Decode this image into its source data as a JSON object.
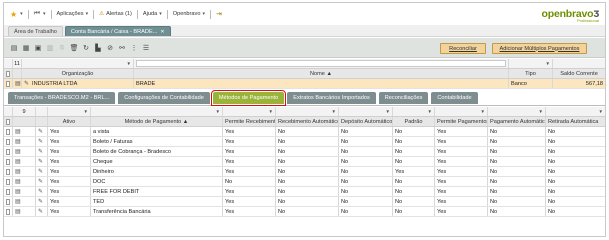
{
  "nav": {
    "applications": "Aplicações",
    "alerts": "Alertas (1)",
    "help": "Ajuda",
    "user": "Openbravo"
  },
  "logo": {
    "main": "openbravo",
    "sub": "Professional"
  },
  "window_tabs": [
    {
      "label": "Área de Trabalho"
    },
    {
      "label": "Conta Bancária / Caixa - BRADE..."
    }
  ],
  "toolbar": {
    "reconcile": "Reconciliar",
    "add_multiple": "Adicionar Múltiplos Pagamentos"
  },
  "header_grid": {
    "filter_count": "11",
    "columns": [
      "Organização",
      "Nome ▲",
      "Tipo",
      "Saldo Corrente"
    ],
    "row": {
      "org": "INDUSTRIA LTDA",
      "name": "BRADE",
      "type": "Banco",
      "balance": "567,18"
    }
  },
  "sub_tabs": [
    {
      "label": "Transações - BRADESCO.M2 - BRL..."
    },
    {
      "label": "Configurações de Contabilidade"
    },
    {
      "label": "Métodos de Pagamento"
    },
    {
      "label": "Extratos Bancários Importados"
    },
    {
      "label": "Reconciliações"
    },
    {
      "label": "Contabilidade"
    }
  ],
  "sub_grid": {
    "filter_count": "9",
    "columns": [
      "Ativo",
      "Método de Pagamento ▲",
      "Permite Recebimento",
      "Recebimento Automático",
      "Depósito Automático",
      "Padrão",
      "Permite Pagamentos",
      "Pagamento Automático",
      "Retirada Automática"
    ],
    "rows": [
      [
        "Yes",
        "a vista",
        "Yes",
        "No",
        "No",
        "No",
        "Yes",
        "No",
        "No"
      ],
      [
        "Yes",
        "Boleto / Faturas",
        "Yes",
        "No",
        "No",
        "No",
        "Yes",
        "No",
        "No"
      ],
      [
        "Yes",
        "Boleto de Cobrança - Bradesco",
        "Yes",
        "No",
        "No",
        "No",
        "Yes",
        "No",
        "No"
      ],
      [
        "Yes",
        "Cheque",
        "Yes",
        "No",
        "No",
        "No",
        "Yes",
        "No",
        "No"
      ],
      [
        "Yes",
        "Dinheiro",
        "Yes",
        "No",
        "No",
        "Yes",
        "Yes",
        "No",
        "No"
      ],
      [
        "Yes",
        "DOC",
        "No",
        "No",
        "No",
        "No",
        "Yes",
        "No",
        "No"
      ],
      [
        "Yes",
        "FREE FOR DEBIT",
        "Yes",
        "No",
        "No",
        "No",
        "Yes",
        "No",
        "No"
      ],
      [
        "Yes",
        "TED",
        "Yes",
        "No",
        "No",
        "No",
        "Yes",
        "No",
        "No"
      ],
      [
        "Yes",
        "Transferência Bancária",
        "Yes",
        "No",
        "No",
        "No",
        "Yes",
        "No",
        "No"
      ]
    ]
  },
  "colors": {
    "accent_green": "#9ab43a",
    "active_window_tab": "#6f8f93",
    "button_orange": "#f1d39b",
    "highlight_red": "#e00b0b"
  }
}
